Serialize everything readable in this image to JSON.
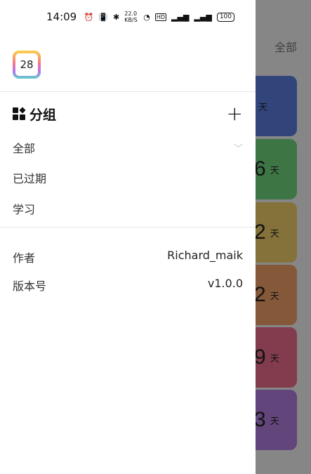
{
  "status_bar": {
    "time": "14:09",
    "net_speed": "22.0 KB/S",
    "battery": "100"
  },
  "app": {
    "icon_day": "28"
  },
  "drawer": {
    "group_section": {
      "title": "分组",
      "items": [
        {
          "label": "全部"
        },
        {
          "label": "已过期"
        },
        {
          "label": "学习"
        }
      ]
    },
    "info": [
      {
        "label": "作者",
        "value": "Richard_maik"
      },
      {
        "label": "版本号",
        "value": "v1.0.0"
      }
    ]
  },
  "background": {
    "tab_label": "全部",
    "cards": [
      {
        "num": "",
        "unit": "天",
        "color": "#5b7ee0"
      },
      {
        "num": "6",
        "unit": "天",
        "color": "#72d67f"
      },
      {
        "num": "2",
        "unit": "天",
        "color": "#f0cf6a"
      },
      {
        "num": "2",
        "unit": "天",
        "color": "#f2a06a"
      },
      {
        "num": "9",
        "unit": "天",
        "color": "#ee6e8c"
      },
      {
        "num": "3",
        "unit": "天",
        "color": "#b27fe0"
      }
    ]
  },
  "colors": {
    "scrim": "rgba(0,0,0,0.45)",
    "divider": "#e6e6e6"
  }
}
